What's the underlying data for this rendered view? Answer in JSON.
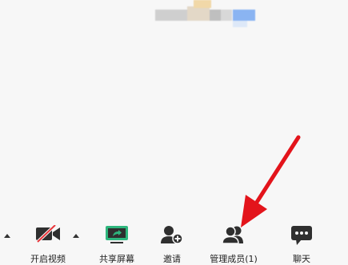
{
  "toolbar": {
    "video_label": "开启视频",
    "share_label": "共享屏幕",
    "invite_label": "邀请",
    "members_label": "管理成员(1)",
    "chat_label": "聊天"
  },
  "icons": {
    "audio_caret": "caret-up-icon",
    "video": "video-off-icon",
    "video_caret": "caret-up-icon",
    "share": "share-screen-icon",
    "invite": "add-user-icon",
    "members": "members-icon",
    "chat": "chat-icon",
    "annotation": "red-arrow-icon"
  },
  "colors": {
    "background": "#f7f7f7",
    "icon_dark": "#2f2f2f",
    "share_green": "#2eb67d",
    "video_slash": "#e8353a",
    "annotation_arrow": "#e3141b"
  }
}
